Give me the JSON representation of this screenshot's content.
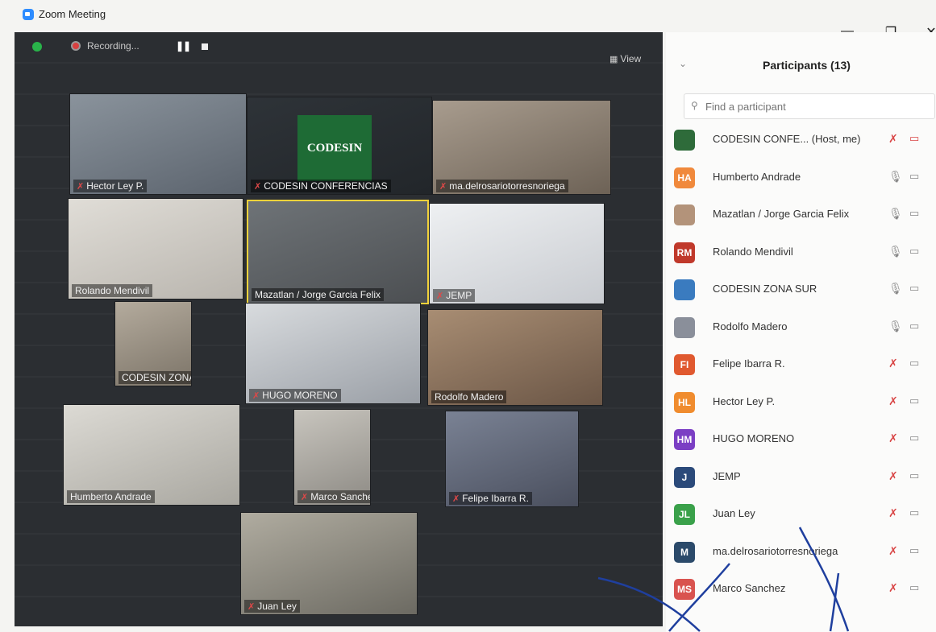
{
  "window": {
    "title": "Zoom Meeting",
    "minimize": "—",
    "restore": "❐",
    "close": "✕"
  },
  "meeting": {
    "recording_label": "Recording...",
    "pause_glyph": "❚❚",
    "view_label": "View",
    "view_glyph": "▦"
  },
  "tiles": [
    {
      "name": "Hector Ley P.",
      "muted": true
    },
    {
      "name": "CODESIN CONFERENCIAS",
      "muted": true
    },
    {
      "name": "ma.delrosariotorresnoriega",
      "muted": true
    },
    {
      "name": "Rolando Mendivil",
      "muted": false
    },
    {
      "name": "Mazatlan / Jorge Garcia Felix",
      "muted": false
    },
    {
      "name": "JEMP",
      "muted": true
    },
    {
      "name": "CODESIN ZONA SUR",
      "muted": false
    },
    {
      "name": "HUGO MORENO",
      "muted": true
    },
    {
      "name": "Rodolfo Madero",
      "muted": false
    },
    {
      "name": "Humberto Andrade",
      "muted": false
    },
    {
      "name": "Marco Sanchez",
      "muted": true
    },
    {
      "name": "Felipe Ibarra R.",
      "muted": true
    },
    {
      "name": "Juan Ley",
      "muted": true
    }
  ],
  "codesin_logo_text": "CODESIN",
  "mic_muted_glyph": "✗",
  "participants_panel": {
    "chevron": "⌄",
    "title": "Participants (13)",
    "search_placeholder": "Find a participant",
    "search_glyph": "⚲",
    "mic_glyph": "🎙",
    "cam_glyph": "▭",
    "list": [
      {
        "initials": "",
        "name": "CODESIN CONFE... (Host, me)",
        "color": "#2e6b3a",
        "mic_muted": true,
        "cam_off": true
      },
      {
        "initials": "HA",
        "name": "Humberto Andrade",
        "color": "#f0893c",
        "mic_muted": false,
        "cam_off": false
      },
      {
        "initials": "",
        "name": "Mazatlan / Jorge Garcia Felix",
        "color": "#b3937a",
        "mic_muted": false,
        "cam_off": false
      },
      {
        "initials": "RM",
        "name": "Rolando Mendivil",
        "color": "#c0392b",
        "mic_muted": false,
        "cam_off": false
      },
      {
        "initials": "",
        "name": "CODESIN ZONA SUR",
        "color": "#3a7bbf",
        "mic_muted": false,
        "cam_off": false
      },
      {
        "initials": "",
        "name": "Rodolfo Madero",
        "color": "#8a8f9a",
        "mic_muted": false,
        "cam_off": false
      },
      {
        "initials": "FI",
        "name": "Felipe Ibarra R.",
        "color": "#e0592f",
        "mic_muted": true,
        "cam_off": false
      },
      {
        "initials": "HL",
        "name": "Hector Ley P.",
        "color": "#f08c2e",
        "mic_muted": true,
        "cam_off": false
      },
      {
        "initials": "HM",
        "name": "HUGO MORENO",
        "color": "#7b3fc4",
        "mic_muted": true,
        "cam_off": false
      },
      {
        "initials": "J",
        "name": "JEMP",
        "color": "#2b4a7a",
        "mic_muted": true,
        "cam_off": false
      },
      {
        "initials": "JL",
        "name": "Juan Ley",
        "color": "#3aa14a",
        "mic_muted": true,
        "cam_off": false
      },
      {
        "initials": "M",
        "name": "ma.delrosariotorresnoriega",
        "color": "#2b4a6a",
        "mic_muted": true,
        "cam_off": false
      },
      {
        "initials": "MS",
        "name": "Marco Sanchez",
        "color": "#d9534f",
        "mic_muted": true,
        "cam_off": false
      }
    ]
  }
}
